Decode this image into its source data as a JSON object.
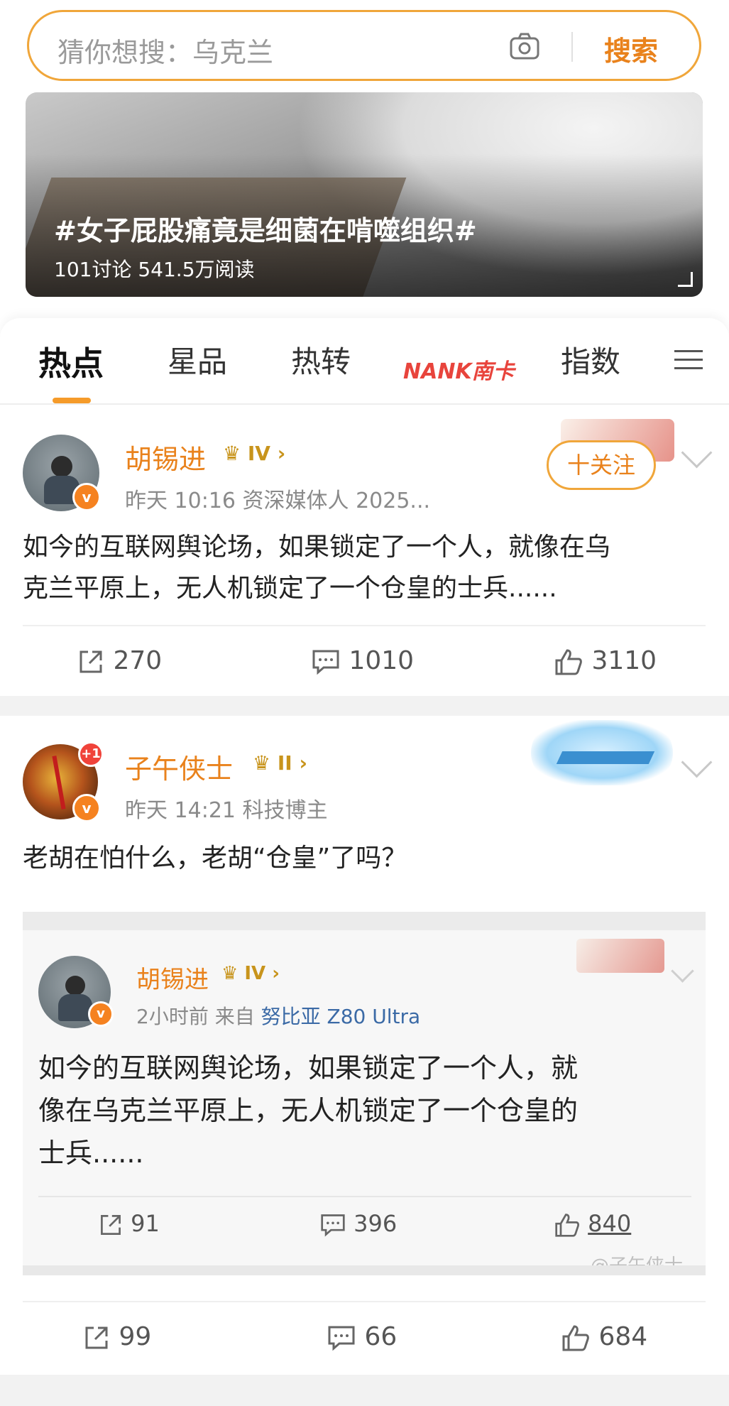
{
  "search": {
    "placeholder": "猜你想搜：乌克兰",
    "button": "搜索"
  },
  "banner": {
    "title": "#女子屁股痛竟是细菌在啃噬组织#",
    "stats": "101讨论  541.5万阅读"
  },
  "tabs": [
    {
      "label": "热点",
      "active": true
    },
    {
      "label": "星品"
    },
    {
      "label": "热转"
    },
    {
      "label": "NANK南卡",
      "logo": true
    },
    {
      "label": "指数"
    }
  ],
  "post1": {
    "username": "胡锡进",
    "level": "IV",
    "meta": "昨天 10:16  资深媒体人 2025...",
    "follow_label": "十关注",
    "text_line1": "如今的互联网舆论场，如果锁定了一个人，就像在乌",
    "text_line2": "克兰平原上，无人机锁定了一个仓皇的士兵......",
    "reposts": "270",
    "comments": "1010",
    "likes": "3110"
  },
  "post2": {
    "username": "子午侠士",
    "level": "II",
    "avatar_badge": "+1",
    "meta": "昨天 14:21  科技博主",
    "text": "老胡在怕什么，老胡“仓皇”了吗？",
    "reposts": "99",
    "comments": "66",
    "likes": "684"
  },
  "quoted": {
    "username": "胡锡进",
    "level": "IV",
    "meta_time": "2小时前  来自",
    "meta_device": "努比亚 Z80 Ultra",
    "text_line1": "如今的互联网舆论场，如果锁定了一个人，就",
    "text_line2": "像在乌克兰平原上，无人机锁定了一个仓皇的",
    "text_line3": "士兵......",
    "reposts": "91",
    "comments": "396",
    "likes": "840",
    "watermark": "@子午侠士"
  },
  "colors": {
    "accent": "#e9821c",
    "verified": "#f58220",
    "tab_indicator": "#f59b2a"
  }
}
